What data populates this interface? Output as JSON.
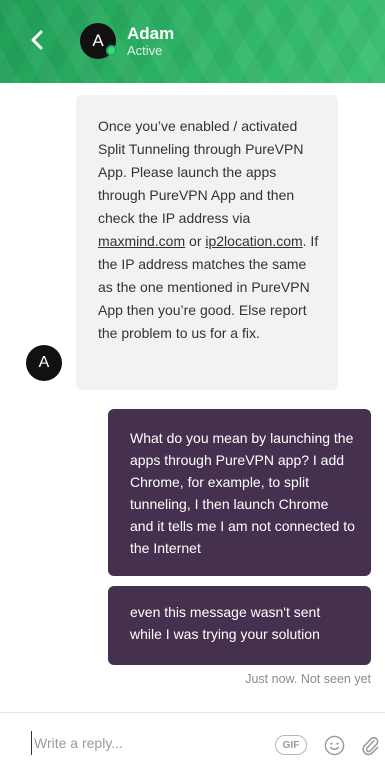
{
  "header": {
    "avatar_initial": "A",
    "agent_name": "Adam",
    "status": "Active"
  },
  "conversation": {
    "incoming": {
      "avatar_initial": "A",
      "text_before_link1": "Once you’ve enabled / activated Split Tunneling through PureVPN App. Please launch the apps through PureVPN App and then check the IP address via ",
      "link1": "maxmind.com",
      "text_between_links": " or ",
      "link2": "ip2location.com",
      "text_after_link2": ". If the IP address matches the same as the one mentioned in PureVPN App then you’re good. Else report the problem to us for a fix."
    },
    "outgoing": [
      {
        "text": "What do you mean by launching the apps through PureVPN app? I add Chrome, for example, to split tunneling, I then launch Chrome and it tells me I am not connected to the Internet"
      },
      {
        "text": "even this message wasn't sent while I was trying your solution"
      }
    ],
    "receipt": "Just now. Not seen yet"
  },
  "composer": {
    "placeholder": "Write a reply...",
    "gif_label": "GIF"
  },
  "colors": {
    "header_green": "#2fb567",
    "outgoing_bubble": "#46304f",
    "incoming_bubble": "#f2f2f2",
    "online_dot": "#2ee06f"
  }
}
